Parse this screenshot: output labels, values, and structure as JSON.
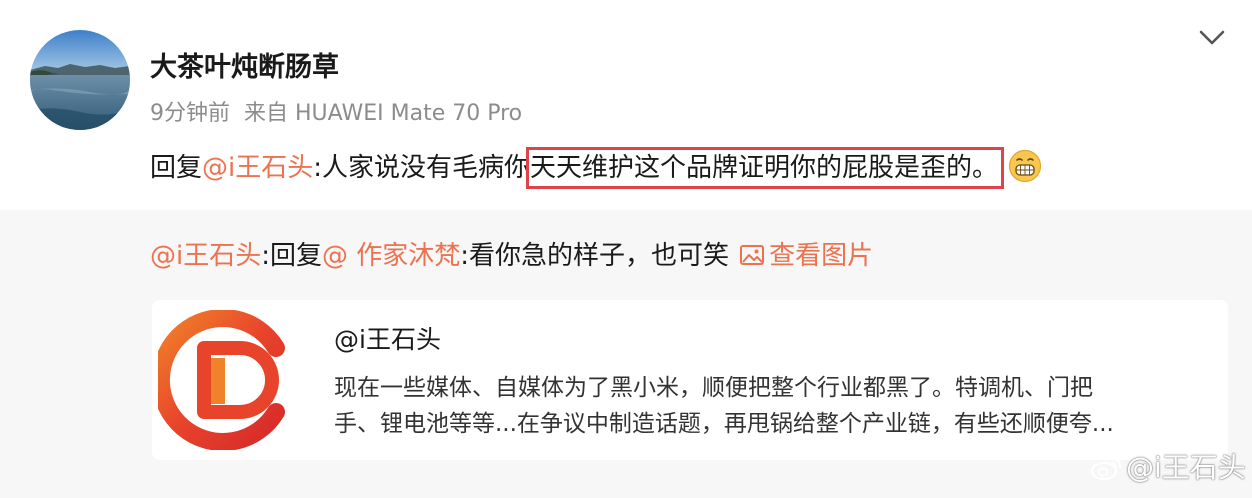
{
  "post": {
    "author": "大茶叶炖断肠草",
    "time": "9分钟前",
    "source": "来自 HUAWEI Mate 70 Pro",
    "reply_prefix": "回复",
    "reply_mention": "@i王石头",
    "reply_colon": ":",
    "reply_text_plain": "人家说没有毛病你",
    "reply_text_highlighted": "天天维护这个品牌证明你的屁股是歪的。",
    "emoji": "grin-emoji"
  },
  "retweet": {
    "author_mention": "@i王石头",
    "colon1": ":",
    "reply_prefix": "回复",
    "reply_mention": "@ 作家沐梵",
    "colon2": ":",
    "text": "看你急的样子，也可笑",
    "view_image_label": "查看图片"
  },
  "card": {
    "title": "@i王石头",
    "desc_line1": "现在一些媒体、自媒体为了黑小米，顺便把整个行业都黑了。特调机、门把",
    "desc_line2": "手、锂电池等等...在争议中制造话题，再甩锅给整个产业链，有些还顺便夸..."
  },
  "watermark": "@i王石头",
  "colors": {
    "accent": "#eb7350",
    "highlight_border": "#e0424a",
    "retweet_bg": "#f7f7f7"
  }
}
